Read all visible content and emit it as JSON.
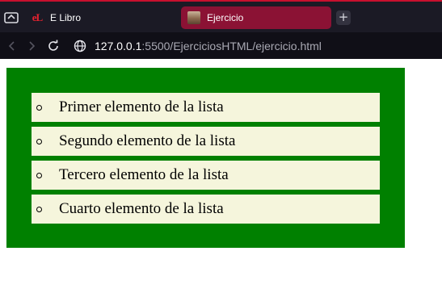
{
  "browser": {
    "tabs": [
      {
        "title": "E Libro",
        "favicon": "elibro-logo",
        "active": false
      },
      {
        "title": "Ejercicio",
        "favicon": "page-thumbnail",
        "active": true
      }
    ],
    "new_tab_label": "+",
    "url_host": "127.0.0.1",
    "url_rest": ":5500/EjerciciosHTML/ejercicio.html",
    "favicon_text": "eL",
    "colors": {
      "accent": "#c8102e",
      "active_tab": "#8b1234",
      "tabstrip": "#1b1a25"
    }
  },
  "page": {
    "container_color": "#008000",
    "item_color": "#f5f5dc",
    "items": [
      "Primer elemento de la lista",
      "Segundo elemento de la lista",
      "Tercero elemento de la lista",
      "Cuarto elemento de la lista"
    ]
  }
}
